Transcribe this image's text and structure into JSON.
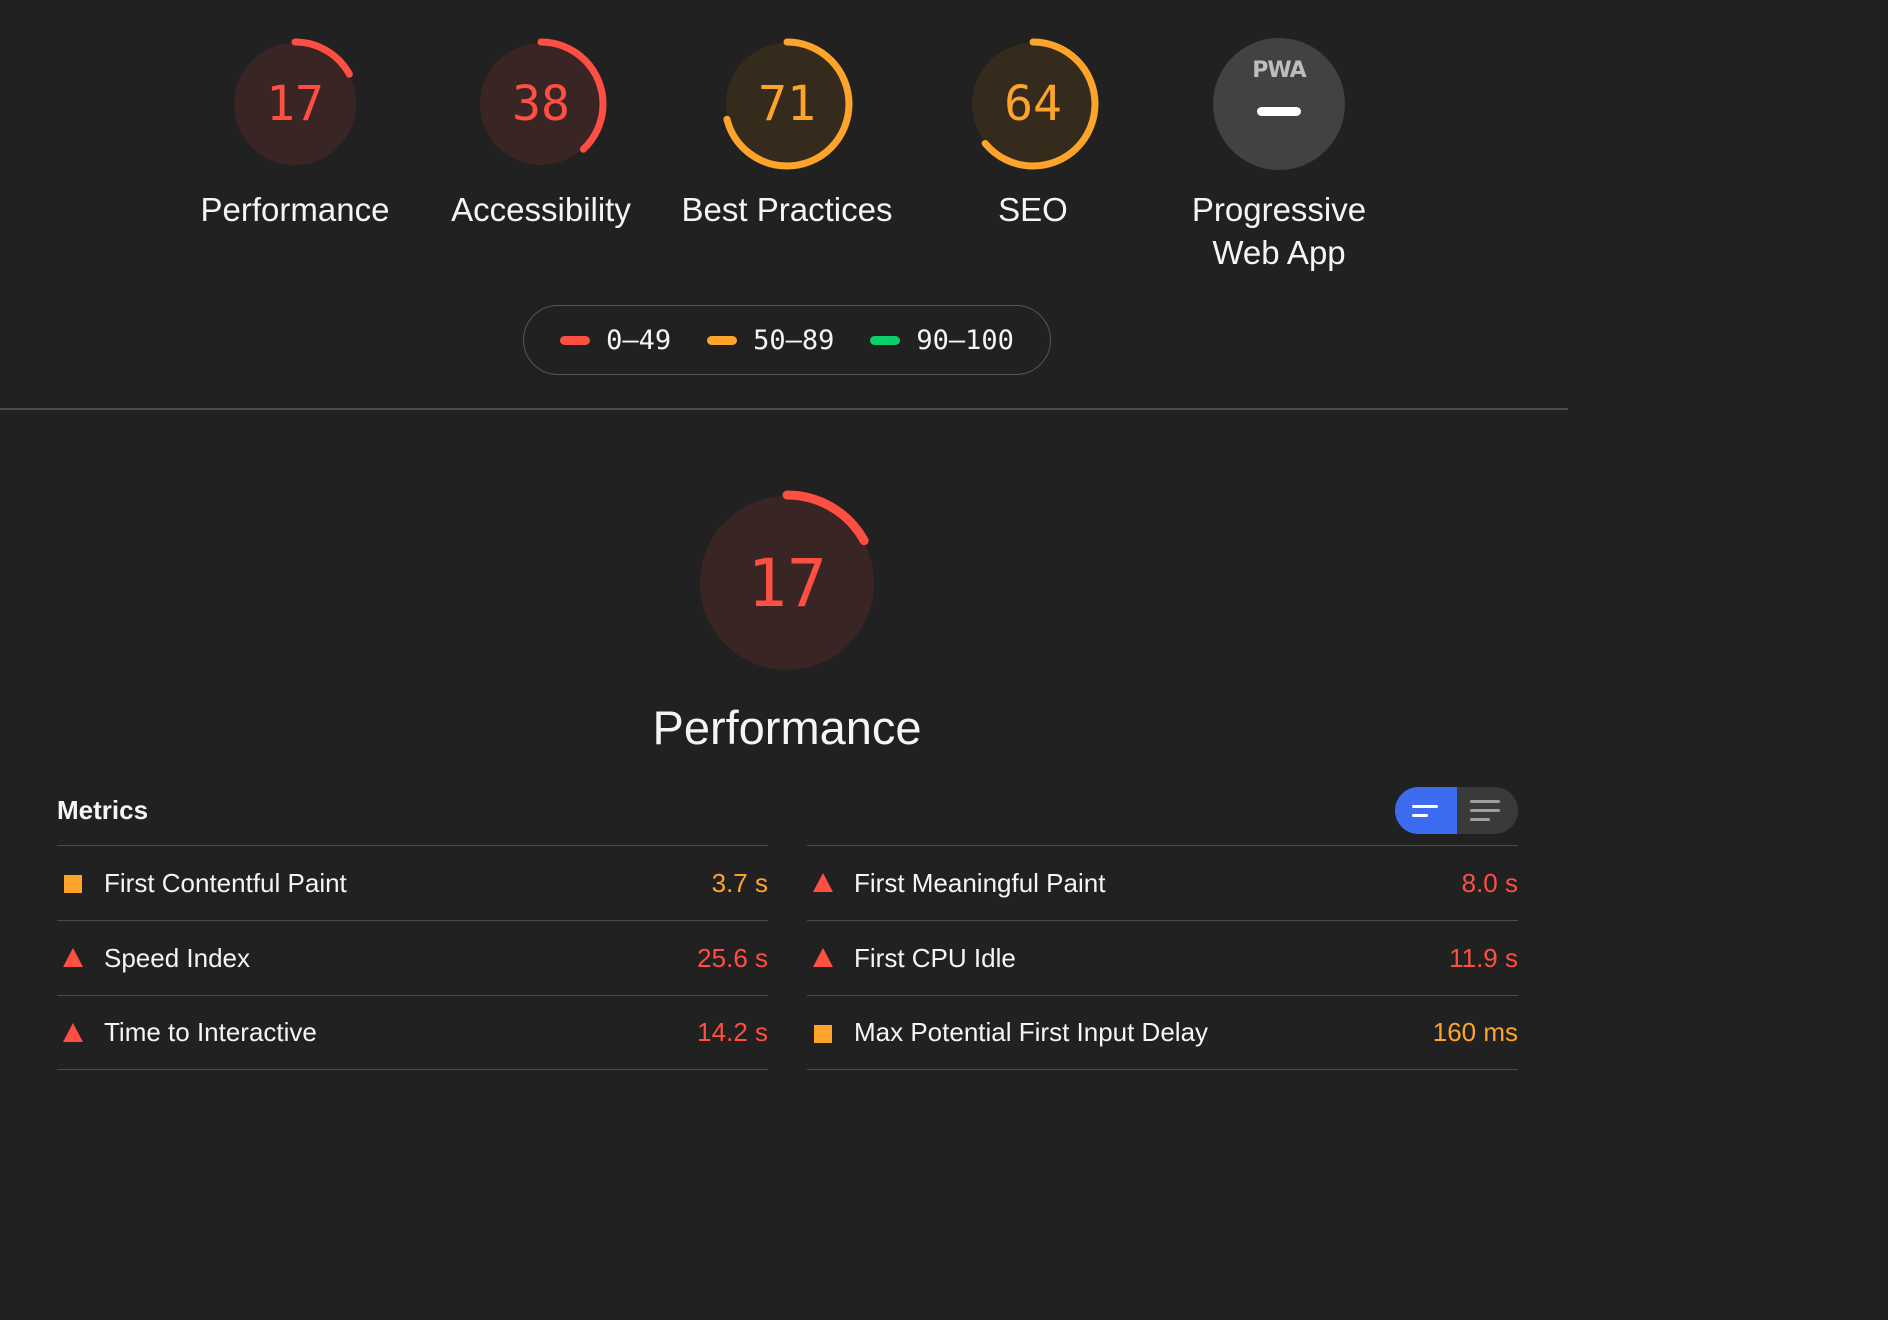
{
  "colors": {
    "fail": "#ff4e42",
    "average": "#ffa42a",
    "pass": "#0cce6b",
    "na": "#424242"
  },
  "categories": [
    {
      "label": "Performance",
      "score": "17",
      "value": 17,
      "rating": "fail"
    },
    {
      "label": "Accessibility",
      "score": "38",
      "value": 38,
      "rating": "fail"
    },
    {
      "label": "Best Practices",
      "score": "71",
      "value": 71,
      "rating": "average"
    },
    {
      "label": "SEO",
      "score": "64",
      "value": 64,
      "rating": "average"
    },
    {
      "label_line1": "Progressive",
      "label_line2": "Web App",
      "badge": "PWA",
      "rating": "na"
    }
  ],
  "legend": [
    {
      "label": "0–49",
      "rating": "fail"
    },
    {
      "label": "50–89",
      "rating": "average"
    },
    {
      "label": "90–100",
      "rating": "pass"
    }
  ],
  "performance": {
    "score": "17",
    "value": 17,
    "title": "Performance"
  },
  "metrics": {
    "title": "Metrics",
    "toggle_icons": [
      "compact-view-icon",
      "expanded-view-icon"
    ],
    "left": [
      {
        "label": "First Contentful Paint",
        "value": "3.7 s",
        "rating": "average"
      },
      {
        "label": "Speed Index",
        "value": "25.6 s",
        "rating": "fail"
      },
      {
        "label": "Time to Interactive",
        "value": "14.2 s",
        "rating": "fail"
      }
    ],
    "right": [
      {
        "label": "First Meaningful Paint",
        "value": "8.0 s",
        "rating": "fail"
      },
      {
        "label": "First CPU Idle",
        "value": "11.9 s",
        "rating": "fail"
      },
      {
        "label": "Max Potential First Input Delay",
        "value": "160 ms",
        "rating": "average"
      }
    ]
  }
}
